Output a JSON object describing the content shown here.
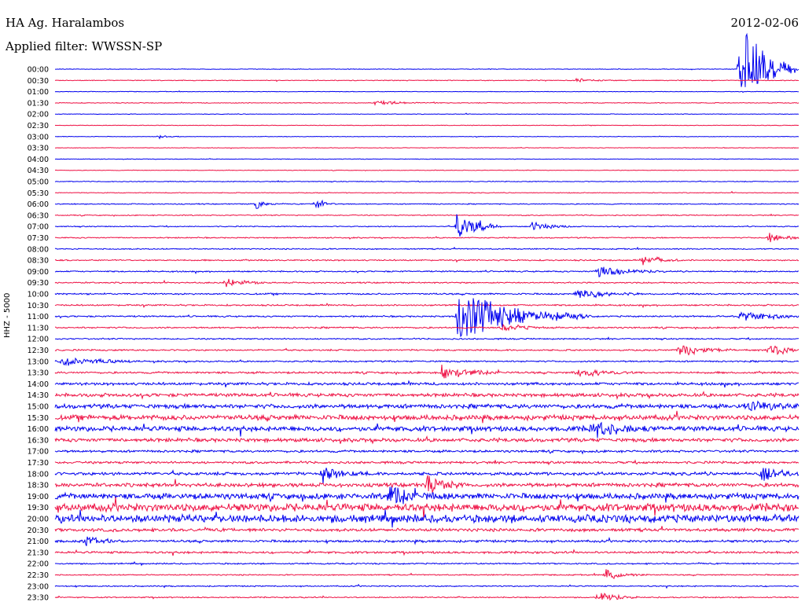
{
  "header": {
    "station": "HA Ag. Haralambos",
    "filter": "Applied filter: WWSSN-SP",
    "date": "2012-02-06"
  },
  "channel_label": "HHZ - 5000",
  "colors": {
    "even_trace": "#0000ee",
    "odd_trace": "#ee1144"
  },
  "chart_data": {
    "type": "line",
    "title": "HA Ag. Haralambos",
    "ylabel": "HHZ - 5000",
    "tick_labels": [
      "00:00",
      "00:30",
      "01:00",
      "01:30",
      "02:00",
      "02:30",
      "03:00",
      "03:30",
      "04:00",
      "04:30",
      "05:00",
      "05:30",
      "06:00",
      "06:30",
      "07:00",
      "07:30",
      "08:00",
      "08:30",
      "09:00",
      "09:30",
      "10:00",
      "10:30",
      "11:00",
      "11:30",
      "12:00",
      "12:30",
      "13:00",
      "13:30",
      "14:00",
      "14:30",
      "15:00",
      "15:30",
      "16:00",
      "16:30",
      "17:00",
      "17:30",
      "18:00",
      "18:30",
      "19:00",
      "19:30",
      "20:00",
      "20:30",
      "21:00",
      "21:30",
      "22:00",
      "22:30",
      "23:00",
      "23:30"
    ],
    "noise_levels": [
      0.3,
      0.4,
      0.3,
      0.4,
      0.3,
      0.3,
      0.3,
      0.3,
      0.3,
      0.3,
      0.4,
      0.4,
      0.5,
      0.5,
      0.5,
      0.6,
      0.6,
      0.7,
      0.7,
      0.7,
      0.8,
      0.8,
      0.8,
      0.8,
      0.7,
      0.8,
      0.8,
      1.0,
      1.4,
      1.8,
      2.2,
      2.6,
      2.6,
      1.9,
      1.2,
      1.2,
      1.6,
      2.0,
      3.0,
      4.0,
      4.0,
      1.6,
      1.2,
      1.1,
      0.7,
      0.6,
      0.6,
      0.6
    ],
    "events": [
      {
        "row": 0,
        "t": 0.92,
        "amp": 70,
        "dur": 0.03
      },
      {
        "row": 1,
        "t": 0.7,
        "amp": 3,
        "dur": 0.02
      },
      {
        "row": 3,
        "t": 0.43,
        "amp": 4,
        "dur": 0.03
      },
      {
        "row": 6,
        "t": 0.14,
        "amp": 3,
        "dur": 0.01
      },
      {
        "row": 12,
        "t": 0.27,
        "amp": 9,
        "dur": 0.01
      },
      {
        "row": 12,
        "t": 0.35,
        "amp": 14,
        "dur": 0.01
      },
      {
        "row": 14,
        "t": 0.54,
        "amp": 30,
        "dur": 0.02
      },
      {
        "row": 14,
        "t": 0.64,
        "amp": 9,
        "dur": 0.02
      },
      {
        "row": 15,
        "t": 0.96,
        "amp": 8,
        "dur": 0.02
      },
      {
        "row": 17,
        "t": 0.79,
        "amp": 9,
        "dur": 0.02
      },
      {
        "row": 18,
        "t": 0.73,
        "amp": 10,
        "dur": 0.03
      },
      {
        "row": 19,
        "t": 0.23,
        "amp": 7,
        "dur": 0.02
      },
      {
        "row": 20,
        "t": 0.7,
        "amp": 10,
        "dur": 0.03
      },
      {
        "row": 22,
        "t": 0.54,
        "amp": 45,
        "dur": 0.06
      },
      {
        "row": 22,
        "t": 0.92,
        "amp": 7,
        "dur": 0.04
      },
      {
        "row": 23,
        "t": 0.6,
        "amp": 8,
        "dur": 0.02
      },
      {
        "row": 25,
        "t": 0.84,
        "amp": 9,
        "dur": 0.03
      },
      {
        "row": 25,
        "t": 0.96,
        "amp": 8,
        "dur": 0.03
      },
      {
        "row": 26,
        "t": 0.01,
        "amp": 8,
        "dur": 0.04
      },
      {
        "row": 27,
        "t": 0.52,
        "amp": 12,
        "dur": 0.03
      },
      {
        "row": 27,
        "t": 0.7,
        "amp": 8,
        "dur": 0.03
      },
      {
        "row": 30,
        "t": 0.93,
        "amp": 10,
        "dur": 0.03
      },
      {
        "row": 32,
        "t": 0.72,
        "amp": 14,
        "dur": 0.03
      },
      {
        "row": 36,
        "t": 0.36,
        "amp": 12,
        "dur": 0.02
      },
      {
        "row": 36,
        "t": 0.95,
        "amp": 12,
        "dur": 0.02
      },
      {
        "row": 37,
        "t": 0.5,
        "amp": 14,
        "dur": 0.02
      },
      {
        "row": 38,
        "t": 0.45,
        "amp": 14,
        "dur": 0.03
      },
      {
        "row": 42,
        "t": 0.04,
        "amp": 8,
        "dur": 0.02
      },
      {
        "row": 45,
        "t": 0.74,
        "amp": 8,
        "dur": 0.02
      },
      {
        "row": 47,
        "t": 0.73,
        "amp": 9,
        "dur": 0.02
      }
    ]
  }
}
